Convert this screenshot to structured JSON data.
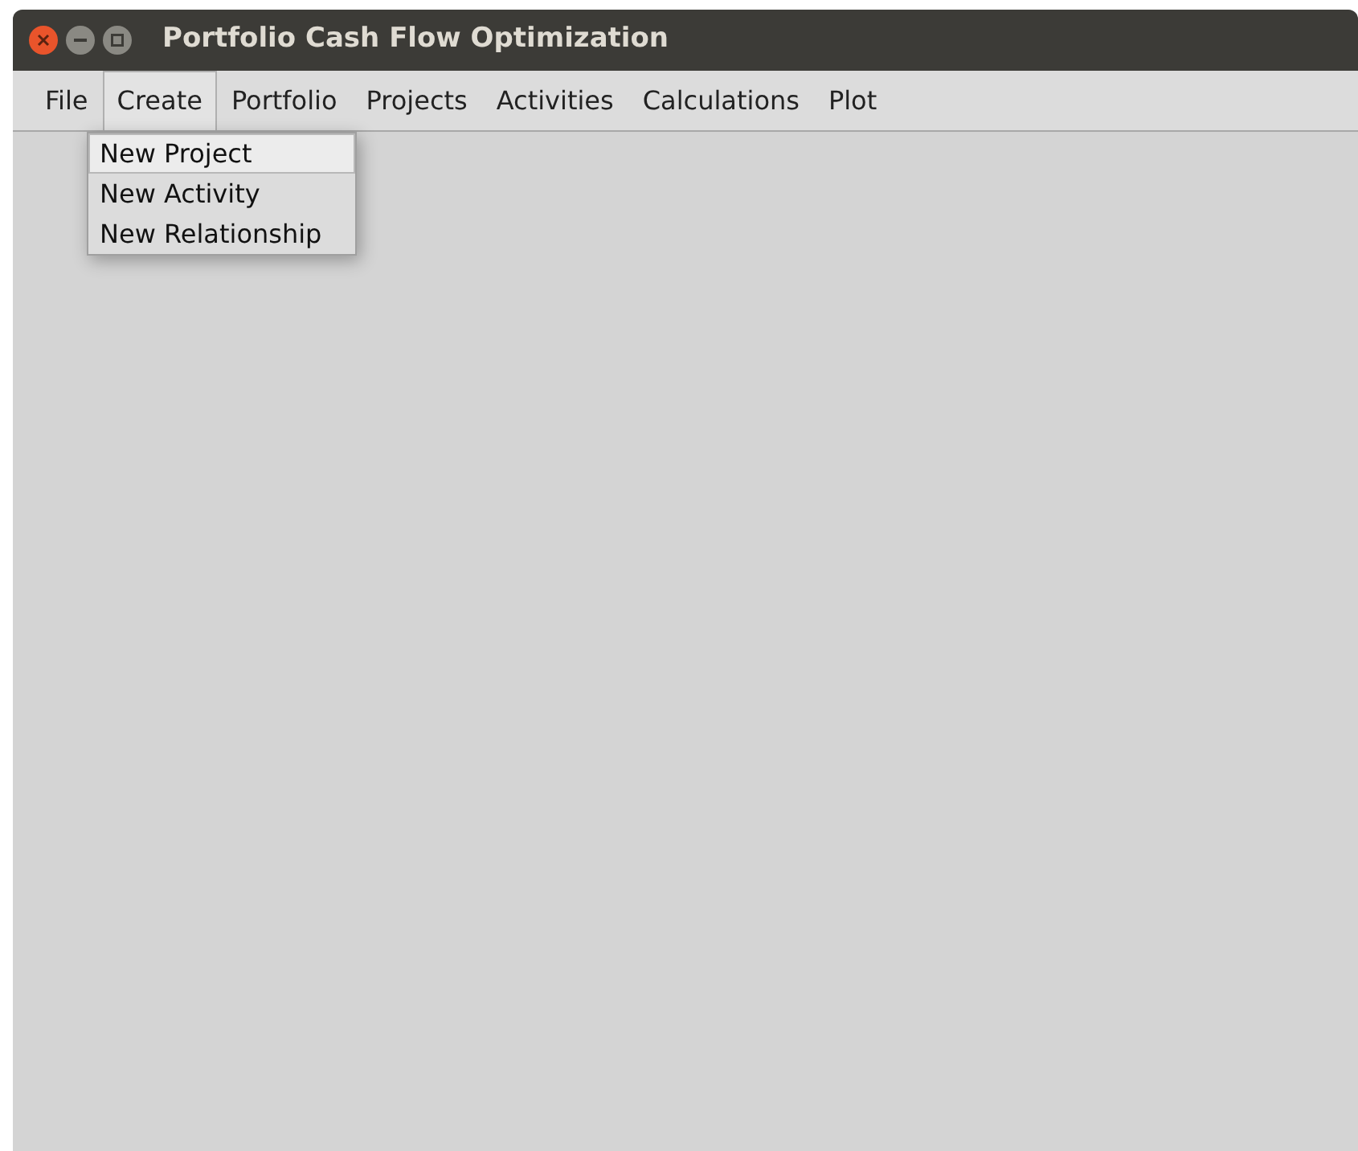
{
  "window": {
    "title": "Portfolio Cash Flow Optimization"
  },
  "menu_bar": [
    {
      "label": "File",
      "selected": false
    },
    {
      "label": "Create",
      "selected": true
    },
    {
      "label": "Portfolio",
      "selected": false
    },
    {
      "label": "Projects",
      "selected": false
    },
    {
      "label": "Activities",
      "selected": false
    },
    {
      "label": "Calculations",
      "selected": false
    },
    {
      "label": "Plot",
      "selected": false
    }
  ],
  "dropdown": [
    {
      "label": "New Project",
      "selected": true
    },
    {
      "label": "New Activity",
      "selected": false
    },
    {
      "label": "New Relationship",
      "selected": false
    }
  ]
}
